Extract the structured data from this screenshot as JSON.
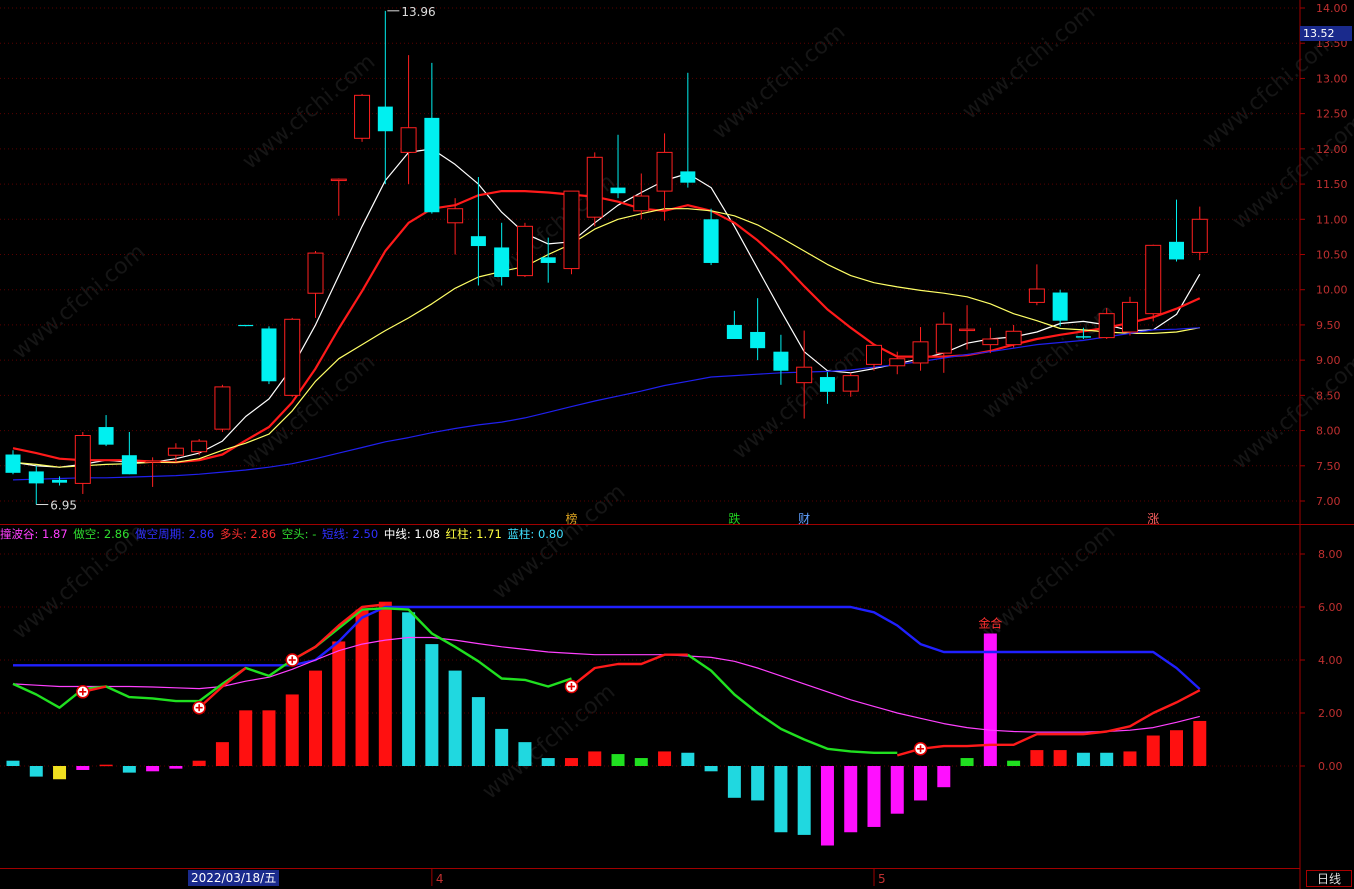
{
  "chart_data": [
    {
      "type": "candlestick",
      "ylim": [
        6.6,
        14.1
      ],
      "yticks": [
        "7.00",
        "7.50",
        "8.00",
        "8.50",
        "9.00",
        "9.50",
        "10.00",
        "10.50",
        "11.00",
        "11.50",
        "12.00",
        "12.50",
        "13.00",
        "13.50",
        "14.00"
      ],
      "last_price": "13.52",
      "annotations": {
        "high": "13.96",
        "low": "6.95"
      },
      "event_markers": [
        {
          "i": 24,
          "text": "榜",
          "color": "#d8a020"
        },
        {
          "i": 31,
          "text": "跌",
          "color": "#20d020"
        },
        {
          "i": 34,
          "text": "财",
          "color": "#60a0ff"
        },
        {
          "i": 49,
          "text": "涨",
          "color": "#ff6060"
        }
      ],
      "candles": [
        {
          "o": 7.66,
          "h": 7.72,
          "l": 7.38,
          "c": 7.4
        },
        {
          "o": 7.42,
          "h": 7.5,
          "l": 6.95,
          "c": 7.25
        },
        {
          "o": 7.3,
          "h": 7.35,
          "l": 7.22,
          "c": 7.26
        },
        {
          "o": 7.25,
          "h": 7.98,
          "l": 7.1,
          "c": 7.93
        },
        {
          "o": 8.05,
          "h": 8.22,
          "l": 7.78,
          "c": 7.8
        },
        {
          "o": 7.65,
          "h": 7.98,
          "l": 7.38,
          "c": 7.38
        },
        {
          "o": 7.55,
          "h": 7.62,
          "l": 7.2,
          "c": 7.57
        },
        {
          "o": 7.65,
          "h": 7.82,
          "l": 7.55,
          "c": 7.75
        },
        {
          "o": 7.7,
          "h": 7.88,
          "l": 7.65,
          "c": 7.85
        },
        {
          "o": 8.02,
          "h": 8.65,
          "l": 7.98,
          "c": 8.62
        },
        {
          "o": 9.5,
          "h": 9.5,
          "l": 9.48,
          "c": 9.49
        },
        {
          "o": 9.45,
          "h": 9.48,
          "l": 8.66,
          "c": 8.7
        },
        {
          "o": 8.5,
          "h": 9.6,
          "l": 8.48,
          "c": 9.58
        },
        {
          "o": 9.95,
          "h": 10.55,
          "l": 9.6,
          "c": 10.52
        },
        {
          "o": 11.55,
          "h": 11.58,
          "l": 11.05,
          "c": 11.57
        },
        {
          "o": 12.15,
          "h": 12.78,
          "l": 12.1,
          "c": 12.76
        },
        {
          "o": 12.6,
          "h": 13.96,
          "l": 11.5,
          "c": 12.25
        },
        {
          "o": 11.95,
          "h": 13.33,
          "l": 11.5,
          "c": 12.3
        },
        {
          "o": 12.44,
          "h": 13.22,
          "l": 11.08,
          "c": 11.1
        },
        {
          "o": 10.95,
          "h": 11.3,
          "l": 10.5,
          "c": 11.15
        },
        {
          "o": 10.76,
          "h": 11.6,
          "l": 10.06,
          "c": 10.62
        },
        {
          "o": 10.6,
          "h": 10.95,
          "l": 10.06,
          "c": 10.18
        },
        {
          "o": 10.2,
          "h": 10.95,
          "l": 10.18,
          "c": 10.9
        },
        {
          "o": 10.46,
          "h": 10.74,
          "l": 10.1,
          "c": 10.38
        },
        {
          "o": 10.3,
          "h": 11.38,
          "l": 10.22,
          "c": 11.4
        },
        {
          "o": 11.03,
          "h": 11.95,
          "l": 10.9,
          "c": 11.88
        },
        {
          "o": 11.45,
          "h": 12.2,
          "l": 11.3,
          "c": 11.37
        },
        {
          "o": 11.12,
          "h": 11.65,
          "l": 11.0,
          "c": 11.33
        },
        {
          "o": 11.4,
          "h": 12.22,
          "l": 10.98,
          "c": 11.95
        },
        {
          "o": 11.68,
          "h": 13.08,
          "l": 11.45,
          "c": 11.52
        },
        {
          "o": 11.0,
          "h": 11.15,
          "l": 10.35,
          "c": 10.38
        },
        {
          "o": 9.5,
          "h": 9.7,
          "l": 9.3,
          "c": 9.3
        },
        {
          "o": 9.4,
          "h": 9.88,
          "l": 9.0,
          "c": 9.17
        },
        {
          "o": 9.12,
          "h": 9.36,
          "l": 8.65,
          "c": 8.85
        },
        {
          "o": 8.68,
          "h": 9.42,
          "l": 8.17,
          "c": 8.9
        },
        {
          "o": 8.76,
          "h": 8.83,
          "l": 8.38,
          "c": 8.55
        },
        {
          "o": 8.56,
          "h": 8.82,
          "l": 8.48,
          "c": 8.78
        },
        {
          "o": 8.94,
          "h": 9.22,
          "l": 8.85,
          "c": 9.21
        },
        {
          "o": 8.92,
          "h": 9.12,
          "l": 8.8,
          "c": 9.02
        },
        {
          "o": 8.96,
          "h": 9.47,
          "l": 8.85,
          "c": 9.26
        },
        {
          "o": 9.1,
          "h": 9.68,
          "l": 8.82,
          "c": 9.51
        },
        {
          "o": 9.42,
          "h": 9.78,
          "l": 9.15,
          "c": 9.44
        },
        {
          "o": 9.22,
          "h": 9.46,
          "l": 9.1,
          "c": 9.3
        },
        {
          "o": 9.22,
          "h": 9.5,
          "l": 9.18,
          "c": 9.41
        },
        {
          "o": 9.82,
          "h": 10.36,
          "l": 9.78,
          "c": 10.01
        },
        {
          "o": 9.96,
          "h": 10.0,
          "l": 9.48,
          "c": 9.56
        },
        {
          "o": 9.34,
          "h": 9.46,
          "l": 9.3,
          "c": 9.32
        },
        {
          "o": 9.32,
          "h": 9.74,
          "l": 9.3,
          "c": 9.66
        },
        {
          "o": 9.4,
          "h": 9.9,
          "l": 9.35,
          "c": 9.82
        },
        {
          "o": 9.66,
          "h": 10.64,
          "l": 9.55,
          "c": 10.63
        },
        {
          "o": 10.68,
          "h": 11.28,
          "l": 10.4,
          "c": 10.43
        },
        {
          "o": 10.53,
          "h": 11.18,
          "l": 10.42,
          "c": 11.0
        }
      ],
      "ma": [
        {
          "color": "#ffffff",
          "values": [
            7.55,
            7.5,
            7.48,
            7.52,
            7.58,
            7.55,
            7.55,
            7.6,
            7.68,
            7.85,
            8.2,
            8.45,
            8.9,
            9.5,
            10.2,
            10.9,
            11.55,
            11.95,
            12.0,
            11.78,
            11.5,
            11.1,
            10.8,
            10.65,
            10.68,
            10.95,
            11.2,
            11.38,
            11.55,
            11.65,
            11.45,
            10.9,
            10.3,
            9.7,
            9.12,
            8.85,
            8.82,
            8.88,
            8.95,
            9.02,
            9.1,
            9.24,
            9.3,
            9.33,
            9.4,
            9.52,
            9.55,
            9.5,
            9.42,
            9.43,
            9.65,
            10.22
          ]
        },
        {
          "color": "#ff1a1a",
          "values": [
            7.75,
            7.68,
            7.6,
            7.58,
            7.58,
            7.58,
            7.56,
            7.55,
            7.58,
            7.66,
            7.86,
            8.05,
            8.4,
            8.88,
            9.45,
            9.98,
            10.55,
            10.95,
            11.15,
            11.2,
            11.34,
            11.4,
            11.4,
            11.38,
            11.35,
            11.32,
            11.25,
            11.15,
            11.12,
            11.2,
            11.12,
            10.95,
            10.7,
            10.4,
            10.05,
            9.72,
            9.46,
            9.22,
            9.05,
            9.05,
            9.05,
            9.07,
            9.13,
            9.22,
            9.3,
            9.36,
            9.41,
            9.46,
            9.53,
            9.61,
            9.73,
            9.88
          ]
        },
        {
          "color": "#ffff66",
          "values": [
            7.55,
            7.52,
            7.48,
            7.5,
            7.52,
            7.53,
            7.55,
            7.55,
            7.6,
            7.72,
            7.82,
            7.95,
            8.28,
            8.7,
            9.02,
            9.22,
            9.42,
            9.6,
            9.8,
            10.02,
            10.18,
            10.26,
            10.33,
            10.5,
            10.65,
            10.86,
            11.0,
            11.08,
            11.15,
            11.15,
            11.12,
            11.05,
            10.92,
            10.74,
            10.55,
            10.36,
            10.2,
            10.1,
            10.04,
            9.99,
            9.95,
            9.9,
            9.8,
            9.66,
            9.56,
            9.45,
            9.43,
            9.4,
            9.38,
            9.38,
            9.4,
            9.46
          ]
        },
        {
          "color": "#2020ee",
          "values": [
            7.3,
            7.31,
            7.32,
            7.33,
            7.33,
            7.34,
            7.35,
            7.36,
            7.38,
            7.41,
            7.44,
            7.48,
            7.53,
            7.6,
            7.68,
            7.76,
            7.84,
            7.9,
            7.97,
            8.03,
            8.08,
            8.12,
            8.18,
            8.26,
            8.34,
            8.42,
            8.49,
            8.56,
            8.64,
            8.7,
            8.76,
            8.78,
            8.8,
            8.82,
            8.83,
            8.84,
            8.86,
            8.9,
            8.94,
            8.98,
            9.03,
            9.08,
            9.12,
            9.17,
            9.22,
            9.25,
            9.28,
            9.33,
            9.38,
            9.43,
            9.44,
            9.46
          ]
        }
      ]
    },
    {
      "type": "bar",
      "ylim": [
        -3.8,
        9.1
      ],
      "yticks": [
        "8.00",
        "6.00",
        "4.00",
        "2.00",
        "0.00"
      ],
      "legend": [
        {
          "text": "撞波谷: 1.87",
          "color": "#ff40ff"
        },
        {
          "text": "做空: 2.86",
          "color": "#30e030"
        },
        {
          "text": "做空周期: 2.86",
          "color": "#3030ff"
        },
        {
          "text": "多头: 2.86",
          "color": "#ff3030"
        },
        {
          "text": "空头: -",
          "color": "#30e030"
        },
        {
          "text": "短线: 2.50",
          "color": "#3030ff"
        },
        {
          "text": "中线: 1.08",
          "color": "#ffffff"
        },
        {
          "text": "红柱: 1.71",
          "color": "#ffff40"
        },
        {
          "text": "蓝柱: 0.80",
          "color": "#40e0ff"
        }
      ],
      "gold_label": "金合",
      "bars": [
        {
          "v": 0.2,
          "c": "cyan"
        },
        {
          "v": -0.4,
          "c": "cyan"
        },
        {
          "v": -0.5,
          "c": "yellow"
        },
        {
          "v": -0.15,
          "c": "magenta"
        },
        {
          "v": 0.05,
          "c": "red"
        },
        {
          "v": -0.25,
          "c": "cyan"
        },
        {
          "v": -0.2,
          "c": "magenta"
        },
        {
          "v": -0.1,
          "c": "magenta"
        },
        {
          "v": 0.2,
          "c": "red"
        },
        {
          "v": 0.9,
          "c": "red"
        },
        {
          "v": 2.1,
          "c": "red"
        },
        {
          "v": 2.1,
          "c": "red"
        },
        {
          "v": 2.7,
          "c": "red"
        },
        {
          "v": 3.6,
          "c": "red"
        },
        {
          "v": 4.7,
          "c": "red"
        },
        {
          "v": 5.9,
          "c": "red"
        },
        {
          "v": 6.2,
          "c": "red"
        },
        {
          "v": 5.8,
          "c": "cyan"
        },
        {
          "v": 4.6,
          "c": "cyan"
        },
        {
          "v": 3.6,
          "c": "cyan"
        },
        {
          "v": 2.6,
          "c": "cyan"
        },
        {
          "v": 1.4,
          "c": "cyan"
        },
        {
          "v": 0.9,
          "c": "cyan"
        },
        {
          "v": 0.3,
          "c": "cyan"
        },
        {
          "v": 0.3,
          "c": "red"
        },
        {
          "v": 0.55,
          "c": "red"
        },
        {
          "v": 0.45,
          "c": "green"
        },
        {
          "v": 0.3,
          "c": "green"
        },
        {
          "v": 0.55,
          "c": "red"
        },
        {
          "v": 0.5,
          "c": "cyan"
        },
        {
          "v": -0.2,
          "c": "cyan"
        },
        {
          "v": -1.2,
          "c": "cyan"
        },
        {
          "v": -1.3,
          "c": "cyan"
        },
        {
          "v": -2.5,
          "c": "cyan"
        },
        {
          "v": -2.6,
          "c": "cyan"
        },
        {
          "v": -3.0,
          "c": "magenta"
        },
        {
          "v": -2.5,
          "c": "magenta"
        },
        {
          "v": -2.3,
          "c": "magenta"
        },
        {
          "v": -1.8,
          "c": "magenta"
        },
        {
          "v": -1.3,
          "c": "magenta"
        },
        {
          "v": -0.8,
          "c": "magenta"
        },
        {
          "v": 0.3,
          "c": "green"
        },
        {
          "v": 5.0,
          "c": "magenta"
        },
        {
          "v": 0.2,
          "c": "green"
        },
        {
          "v": 0.6,
          "c": "red"
        },
        {
          "v": 0.6,
          "c": "red"
        },
        {
          "v": 0.5,
          "c": "cyan"
        },
        {
          "v": 0.5,
          "c": "cyan"
        },
        {
          "v": 0.55,
          "c": "red"
        },
        {
          "v": 1.15,
          "c": "red"
        },
        {
          "v": 1.35,
          "c": "red"
        },
        {
          "v": 1.7,
          "c": "red"
        }
      ],
      "lines": [
        {
          "color": "#2020ff",
          "values": [
            3.8,
            3.8,
            3.8,
            3.8,
            3.8,
            3.8,
            3.8,
            3.8,
            3.8,
            3.8,
            3.8,
            3.8,
            3.8,
            4.0,
            4.7,
            5.6,
            6.0,
            6.0,
            6.0,
            6.0,
            6.0,
            6.0,
            6.0,
            6.0,
            6.0,
            6.0,
            6.0,
            6.0,
            6.0,
            6.0,
            6.0,
            6.0,
            6.0,
            6.0,
            6.0,
            6.0,
            6.0,
            5.8,
            5.3,
            4.6,
            4.3,
            4.3,
            4.3,
            4.3,
            4.3,
            4.3,
            4.3,
            4.3,
            4.3,
            4.3,
            3.7,
            2.9
          ]
        },
        {
          "color": "#ff40ff",
          "values": [
            3.1,
            3.05,
            3.0,
            3.0,
            3.0,
            3.0,
            2.98,
            2.95,
            2.92,
            3.0,
            3.2,
            3.35,
            3.65,
            4.0,
            4.35,
            4.6,
            4.75,
            4.85,
            4.85,
            4.75,
            4.62,
            4.5,
            4.4,
            4.3,
            4.25,
            4.2,
            4.2,
            4.2,
            4.2,
            4.15,
            4.1,
            3.95,
            3.7,
            3.4,
            3.1,
            2.8,
            2.5,
            2.25,
            2.0,
            1.8,
            1.6,
            1.45,
            1.35,
            1.3,
            1.28,
            1.28,
            1.28,
            1.3,
            1.35,
            1.45,
            1.65,
            1.87
          ]
        },
        {
          "color": "#20e020",
          "values": [
            3.1,
            2.7,
            2.2,
            2.9,
            3.0,
            2.6,
            2.55,
            2.45,
            2.45,
            3.1,
            3.7,
            3.4,
            4.0,
            4.5,
            5.2,
            5.9,
            5.95,
            5.9,
            5.0,
            4.5,
            3.95,
            3.3,
            3.25,
            3.0,
            3.3,
            null,
            null,
            null,
            null,
            4.2,
            3.6,
            2.7,
            2.0,
            1.4,
            1.0,
            0.65,
            0.55,
            0.5,
            0.5,
            null,
            null,
            null,
            null,
            null,
            null,
            null,
            null,
            null,
            null,
            null,
            null,
            null
          ]
        },
        {
          "color": "#ff1a1a",
          "values": [
            null,
            null,
            null,
            2.8,
            3.0,
            null,
            null,
            null,
            2.2,
            3.0,
            3.7,
            null,
            4.0,
            4.5,
            5.3,
            6.0,
            6.1,
            null,
            null,
            null,
            null,
            null,
            null,
            null,
            3.0,
            3.7,
            3.85,
            3.85,
            4.2,
            4.2,
            null,
            null,
            null,
            null,
            null,
            null,
            null,
            null,
            0.4,
            0.65,
            0.75,
            0.75,
            0.8,
            0.8,
            1.2,
            1.2,
            1.2,
            1.3,
            1.5,
            2.0,
            2.4,
            2.86
          ]
        }
      ],
      "plus_markers": [
        3,
        8,
        12,
        24,
        39
      ]
    }
  ],
  "date_label": "2022/03/18/五",
  "month_labels": [
    {
      "i": 18,
      "text": "4"
    },
    {
      "i": 37,
      "text": "5"
    }
  ],
  "period_label": "日线",
  "watermark": "www.cfchi.com"
}
